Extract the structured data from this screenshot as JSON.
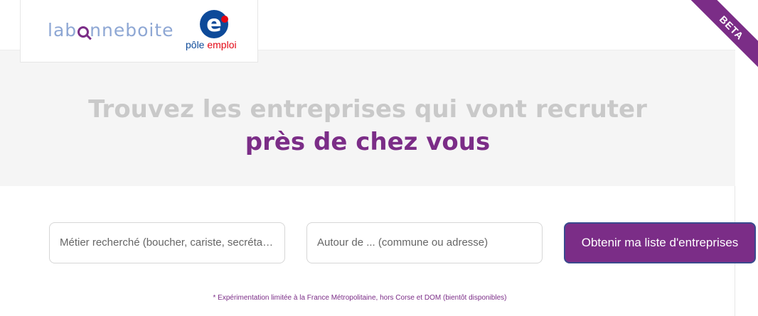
{
  "header": {
    "logo_text_pre": "lab",
    "logo_text_post": "nneboite",
    "partner_logo_line1": "pôle",
    "partner_logo_line2": "emploi",
    "partner_logo_letter": "e",
    "badge": "BETA"
  },
  "hero": {
    "line1": "Trouvez les entreprises qui vont recruter",
    "line2": "près de chez vous"
  },
  "search": {
    "job_placeholder": "Métier recherché (boucher, cariste, secrétaire ...",
    "location_placeholder": "Autour de ... (commune ou adresse)",
    "submit_label": "Obtenir ma liste d'entreprises"
  },
  "footnote": "* Expérimentation limitée à la France Métropolitaine, hors Corse et DOM (bientôt disponibles)",
  "colors": {
    "brand_purple": "#7b2d87",
    "hero_gray": "#c9c9c9",
    "pole_emploi_blue": "#0d4a99",
    "pole_emploi_red": "#e30613"
  }
}
